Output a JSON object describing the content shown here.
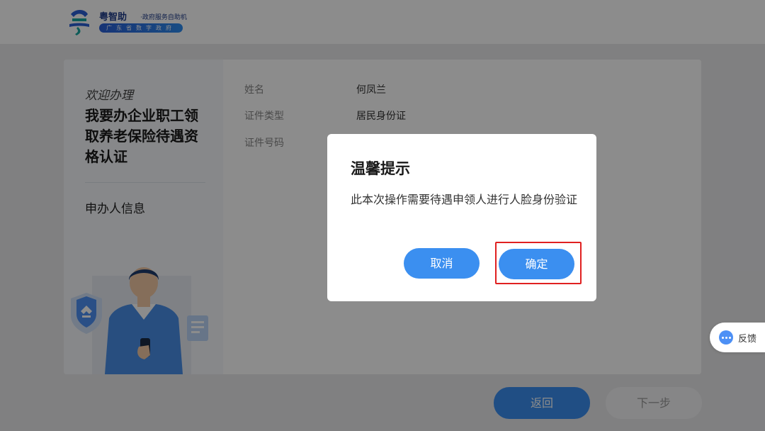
{
  "header": {
    "brand_name": "粤智助",
    "brand_sub": "·政府服务自助机",
    "brand_tagline": "广东省数字政府"
  },
  "left_panel": {
    "welcome": "欢迎办理",
    "service_title": "我要办企业职工领取养老保险待遇资格认证",
    "applicant_label": "申办人信息"
  },
  "form": {
    "rows": [
      {
        "label": "姓名",
        "value": "何凤兰"
      },
      {
        "label": "证件类型",
        "value": "居民身份证"
      },
      {
        "label": "证件号码",
        "value": ""
      }
    ]
  },
  "bottom": {
    "back_label": "返回",
    "next_label": "下一步"
  },
  "modal": {
    "title": "温馨提示",
    "message": "此本次操作需要待遇申领人进行人脸身份验证",
    "cancel_label": "取消",
    "confirm_label": "确定"
  },
  "feedback": {
    "label": "反馈"
  },
  "colors": {
    "primary": "#3b8ff0",
    "highlight": "#e02020",
    "brand": "#1f3d8a"
  }
}
